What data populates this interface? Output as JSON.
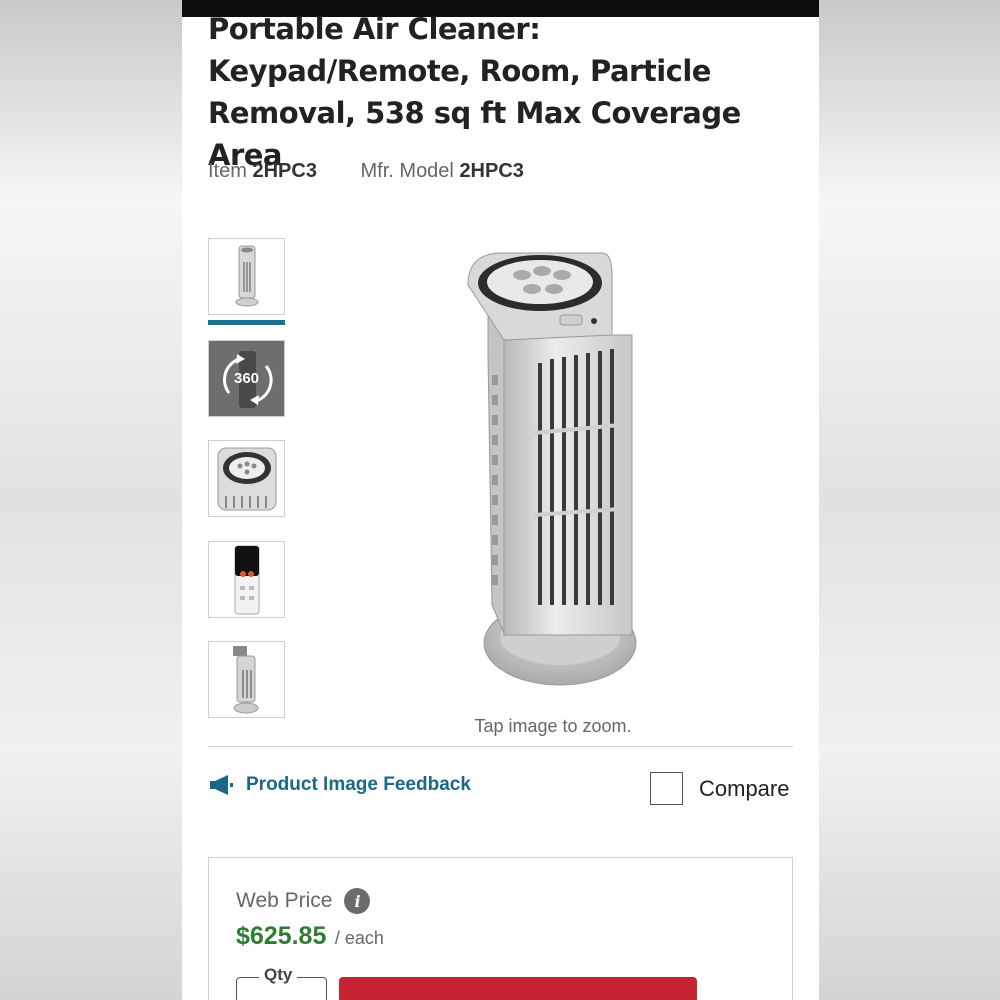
{
  "product": {
    "title": "Portable Air Cleaner: Keypad/Remote, Room, Particle Removal, 538 sq ft Max Coverage Area",
    "item_label": "Item",
    "item_value": "2HPC3",
    "mfr_label": "Mfr. Model",
    "mfr_value": "2HPC3"
  },
  "gallery": {
    "thumbnails": [
      {
        "name": "front view",
        "active": true
      },
      {
        "name": "360 view",
        "label": "360"
      },
      {
        "name": "top keypad view"
      },
      {
        "name": "remote control"
      },
      {
        "name": "filter access view"
      }
    ],
    "zoom_hint": "Tap image to zoom."
  },
  "actions": {
    "feedback_label": "Product Image Feedback",
    "feedback_icon": "megaphone-icon",
    "compare_label": "Compare",
    "compare_checked": false
  },
  "pricing": {
    "web_price_label": "Web Price",
    "info_icon": "i",
    "amount": "$625.85",
    "unit": "/ each",
    "qty_label": "Qty",
    "colors": {
      "price": "#2f7d32",
      "add_button": "#c62333",
      "link": "#1a6787"
    }
  }
}
